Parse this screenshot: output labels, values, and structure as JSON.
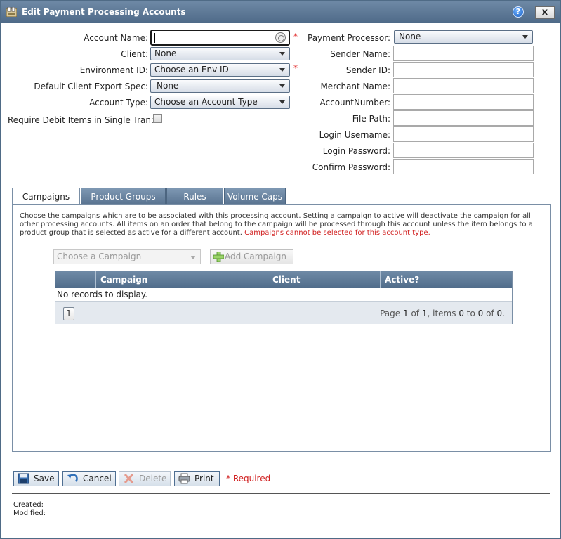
{
  "window": {
    "title": "Edit Payment Processing Accounts",
    "help_label": "?",
    "close_label": "x"
  },
  "form_left": {
    "account_name_label": "Account Name:",
    "account_name_value": "",
    "required_mark": "*",
    "client_label": "Client:",
    "client_value": "None",
    "environment_label": "Environment ID:",
    "environment_value": "Choose an Env ID",
    "export_spec_label": "Default Client Export Spec:",
    "export_spec_value": "None",
    "account_type_label": "Account Type:",
    "account_type_value": "Choose an Account Type",
    "require_debit_label": "Require Debit Items in Single Tran:"
  },
  "form_right": {
    "payment_processor_label": "Payment Processor:",
    "payment_processor_value": "None",
    "sender_name_label": "Sender Name:",
    "sender_id_label": "Sender ID:",
    "merchant_name_label": "Merchant Name:",
    "account_number_label": "AccountNumber:",
    "file_path_label": "File Path:",
    "login_username_label": "Login Username:",
    "login_password_label": "Login Password:",
    "confirm_password_label": "Confirm Password:"
  },
  "tabs": [
    {
      "label": "Campaigns",
      "active": true
    },
    {
      "label": "Product Groups",
      "active": false
    },
    {
      "label": "Rules",
      "active": false
    },
    {
      "label": "Volume Caps",
      "active": false
    }
  ],
  "campaigns_panel": {
    "description": "Choose the campaigns which are to be associated with this processing account. Setting a campaign to active will deactivate the campaign for all other processing accounts. All items on an order that belong to the campaign will be processed through this account unless the item belongs to a product group that is selected as active for a different account.",
    "warning": "Campaigns cannot be selected for this account type.",
    "choose_placeholder": "Choose a Campaign",
    "add_label": "Add Campaign",
    "columns": [
      "Campaign",
      "Client",
      "Active?"
    ],
    "empty_text": "No records to display.",
    "page_number": "1",
    "pager": {
      "prefix": "Page",
      "page": "1",
      "of_text": "of",
      "total_pages": "1",
      "items_text": ", items",
      "from": "0",
      "to_text": "to",
      "to": "0",
      "of2_text": "of",
      "total": "0",
      "end": "."
    }
  },
  "actions": {
    "save": "Save",
    "cancel": "Cancel",
    "delete": "Delete",
    "print": "Print",
    "required_note": "* Required"
  },
  "footer": {
    "created_label": "Created:",
    "modified_label": "Modified:"
  },
  "colors": {
    "titlebar": "#5b7694",
    "required": "#e02020",
    "panel_border": "#7a8fa6"
  }
}
